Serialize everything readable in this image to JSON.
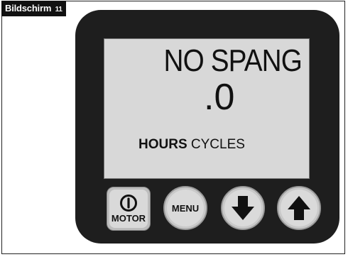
{
  "figure": {
    "label": "Bildschirm",
    "number": "11"
  },
  "display": {
    "line1": "NO SPANG",
    "line2": ".0",
    "line3_bold": "HOURS",
    "line3_normal": "CYCLES"
  },
  "buttons": {
    "motor": {
      "label": "MOTOR",
      "icon": "power-icon"
    },
    "menu": {
      "label": "MENU"
    },
    "down": {
      "icon": "arrow-down-icon"
    },
    "up": {
      "icon": "arrow-up-icon"
    }
  },
  "colors": {
    "device_body": "#1e1e1e",
    "lcd_background": "#d8d8d8",
    "button_face": "#dadada"
  }
}
